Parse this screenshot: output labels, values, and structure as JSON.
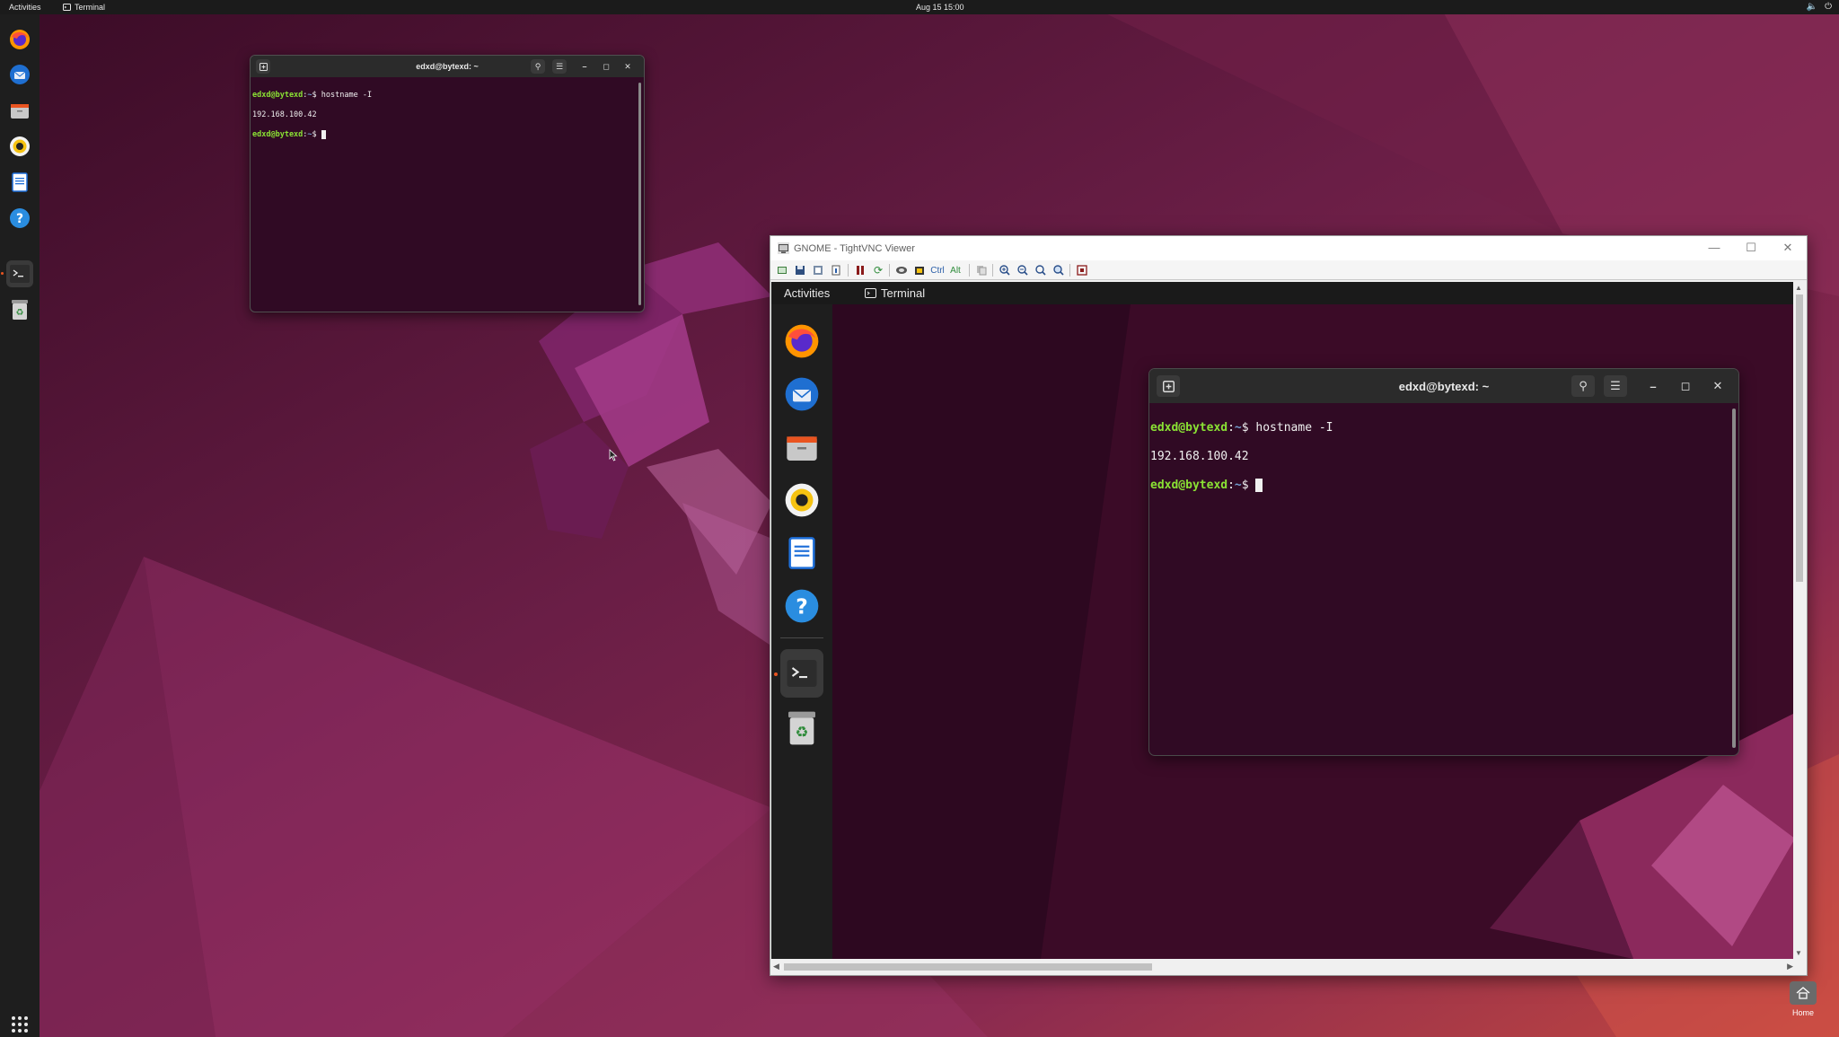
{
  "topbar": {
    "activities": "Activities",
    "app_name": "Terminal",
    "clock": "Aug 15  15:00"
  },
  "host_dock": {
    "items": [
      "firefox",
      "thunderbird",
      "files",
      "rhythmbox",
      "writer",
      "help",
      "terminal",
      "trash"
    ],
    "show_apps": "show-applications"
  },
  "term_small": {
    "title": "edxd@bytexd: ~",
    "lines": [
      {
        "user": "edxd@bytexd",
        "sep": ":",
        "path": "~",
        "cmd": "$ hostname -I"
      },
      {
        "output": "192.168.100.42"
      },
      {
        "user": "edxd@bytexd",
        "sep": ":",
        "path": "~",
        "cmd": "$ "
      }
    ]
  },
  "vnc": {
    "title": "GNOME - TightVNC Viewer",
    "toolbar": {
      "ctrl_label": "Ctrl",
      "alt_label": "Alt"
    },
    "remote": {
      "topbar": {
        "activities": "Activities",
        "app_name": "Terminal"
      },
      "terminal": {
        "title": "edxd@bytexd: ~",
        "lines": [
          {
            "user": "edxd@bytexd",
            "sep": ":",
            "path": "~",
            "cmd": "$ hostname -I"
          },
          {
            "output": "192.168.100.42"
          },
          {
            "user": "edxd@bytexd",
            "sep": ":",
            "path": "~",
            "cmd": "$ "
          }
        ]
      }
    }
  },
  "desktop": {
    "home_label": "Home"
  },
  "colors": {
    "terminal_bg": "#300a24",
    "prompt_user": "#8ae234",
    "prompt_path": "#729fcf",
    "ubuntu_orange": "#e95420"
  }
}
